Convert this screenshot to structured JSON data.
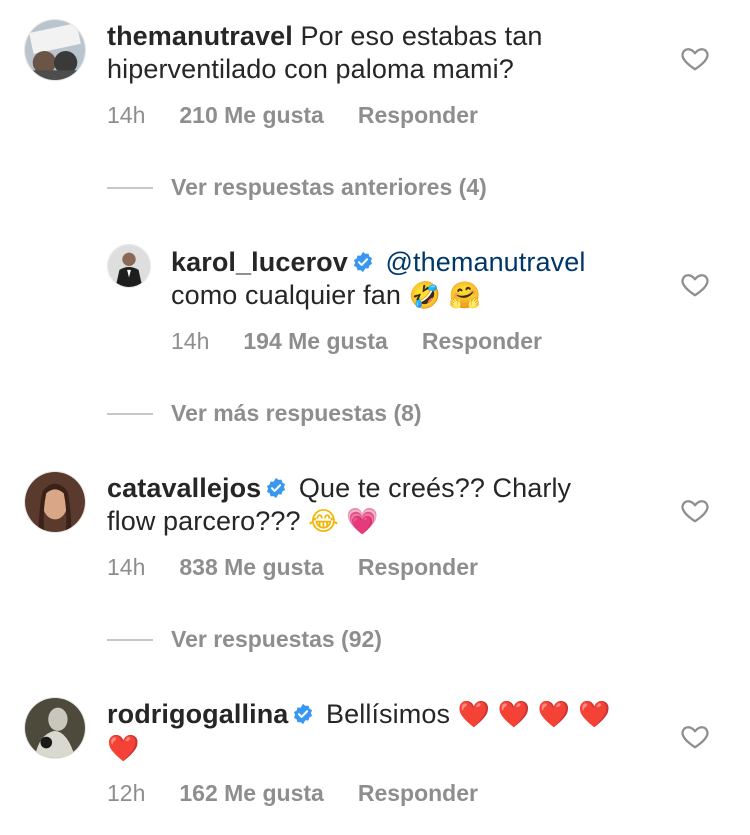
{
  "comments": [
    {
      "username": "themanutravel",
      "text_line1": "Por eso estabas tan",
      "text_line2": "hiperventilado con paloma mami?",
      "time": "14h",
      "likes": "210 Me gusta",
      "reply": "Responder"
    },
    {
      "username": "karol_lucerov",
      "mention": "@themanutravel",
      "text_line2": "como cualquier fan",
      "emojis": [
        "🤣",
        "🤗"
      ],
      "time": "14h",
      "likes": "194 Me gusta",
      "reply": "Responder"
    },
    {
      "username": "catavallejos",
      "text_line1": "Que te creés?? Charly",
      "text_line2": "flow parcero???",
      "emojis": [
        "😂",
        "💗"
      ],
      "time": "14h",
      "likes": "838 Me gusta",
      "reply": "Responder"
    },
    {
      "username": "rodrigogallina",
      "text_line1": "Bellísimos",
      "emojis": [
        "❤️",
        "❤️",
        "❤️",
        "❤️",
        "❤️"
      ],
      "time": "12h",
      "likes": "162 Me gusta",
      "reply": "Responder"
    }
  ],
  "view_replies": {
    "previous": "Ver respuestas anteriores (4)",
    "more": "Ver más respuestas (8)",
    "all": "Ver respuestas (92)"
  },
  "colors": {
    "text": "#262626",
    "secondary": "#8e8e8e",
    "mention": "#00376b",
    "verified": "#3897f0"
  }
}
